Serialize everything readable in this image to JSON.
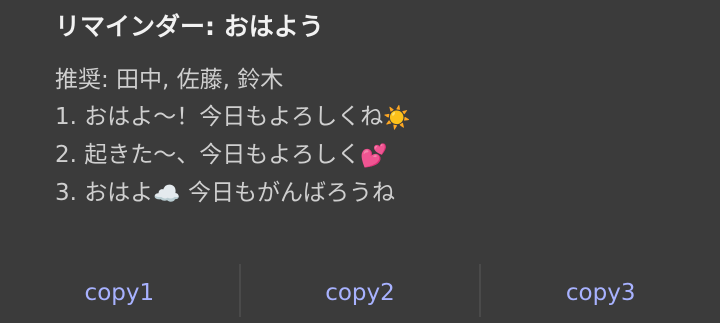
{
  "notification": {
    "title": "リマインダー: おはよう",
    "lines": [
      {
        "text": "推奨: 田中, 佐藤, 鈴木",
        "emoji": ""
      },
      {
        "text": "1. おはよ〜！今日もよろしくね",
        "emoji": "☀️"
      },
      {
        "text": "2. 起きた〜、今日もよろしく",
        "emoji": "💕"
      },
      {
        "text": "3. おはよ",
        "emoji": "☁️",
        "text_after": " 今日もがんばろうね"
      }
    ]
  },
  "actions": [
    {
      "label": "copy1"
    },
    {
      "label": "copy2"
    },
    {
      "label": "copy3"
    }
  ],
  "colors": {
    "background": "#3b3b3b",
    "title": "#f2f2f2",
    "body_text": "#cfcfcf",
    "action_text": "#a8b2ff",
    "divider": "#4a4a4a"
  }
}
